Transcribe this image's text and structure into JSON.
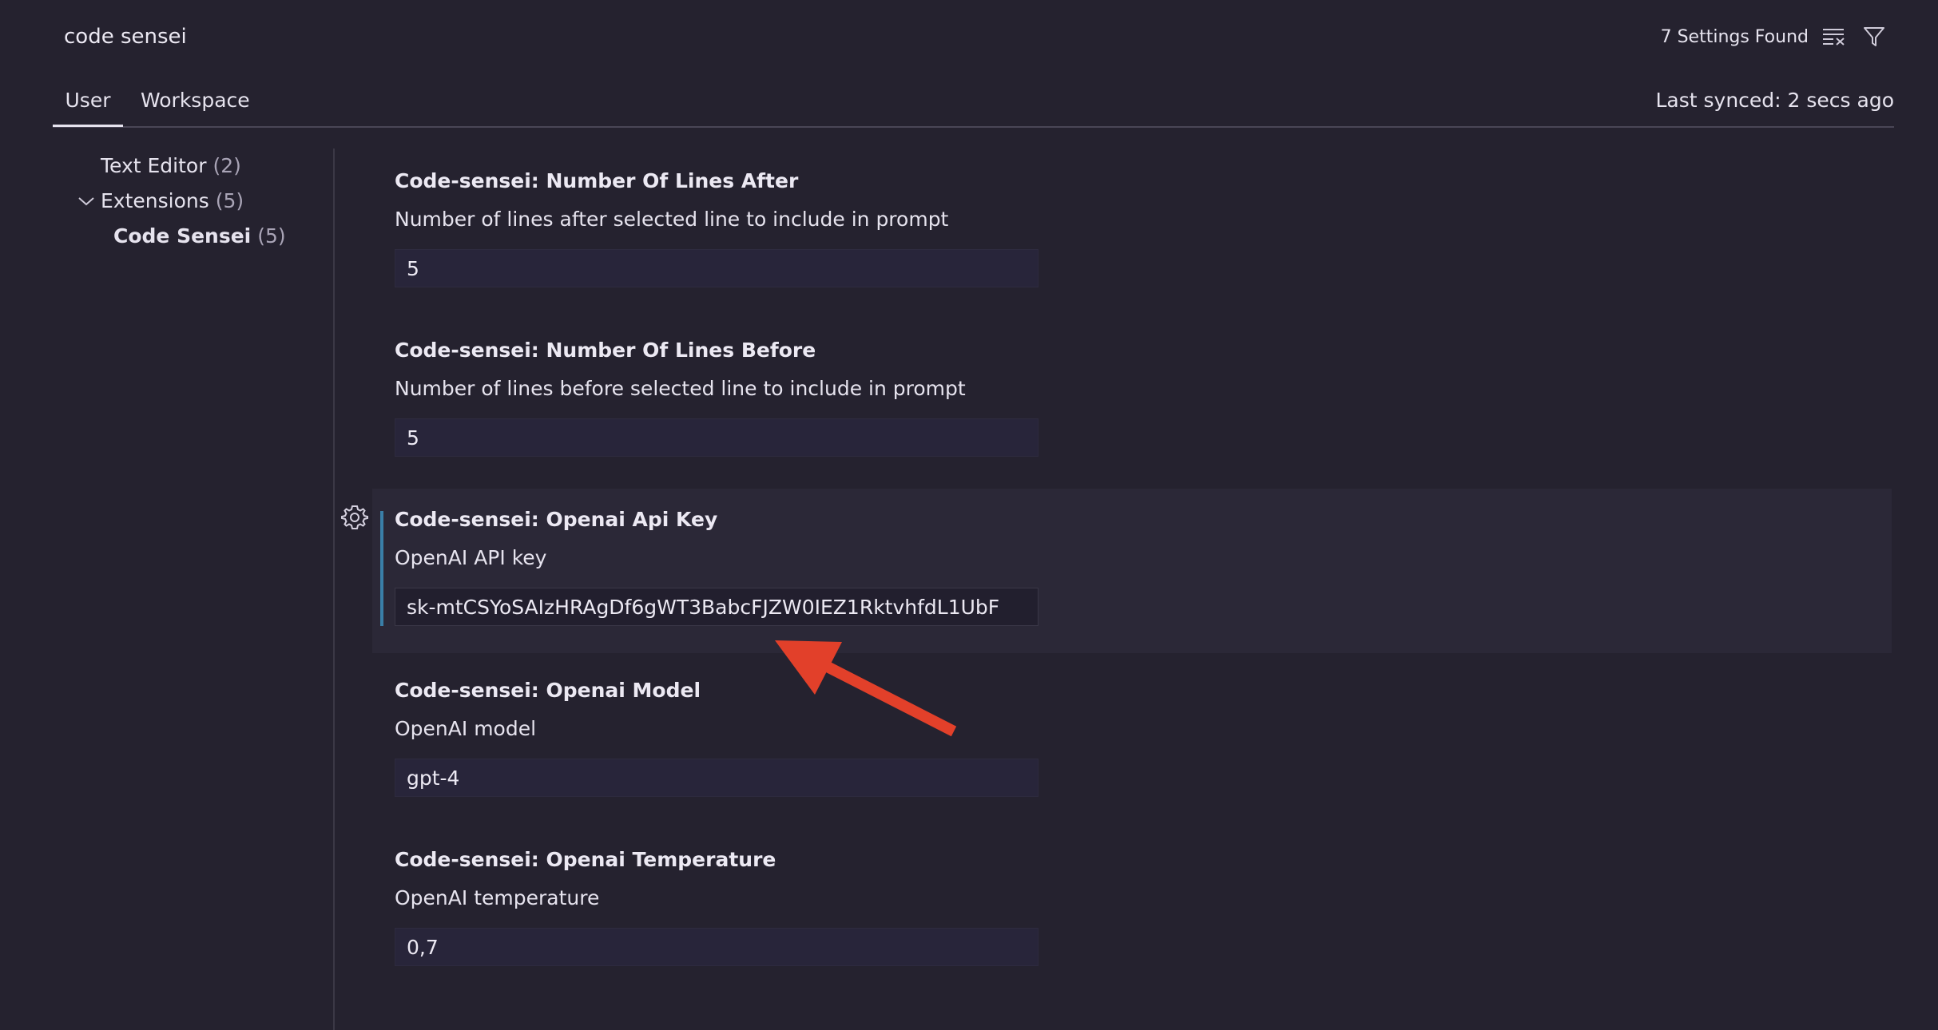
{
  "search": {
    "value": "code sensei",
    "results_count": "7 Settings Found"
  },
  "icons": {
    "clear": "clear-filter-icon",
    "filter": "filter-icon",
    "gear": "gear-icon",
    "chevron": "chevron-down-icon"
  },
  "tabs": {
    "user": "User",
    "workspace": "Workspace",
    "last_synced": "Last synced: 2 secs ago"
  },
  "tree": {
    "text_editor": {
      "label": "Text Editor",
      "count": "(2)"
    },
    "extensions": {
      "label": "Extensions",
      "count": "(5)"
    },
    "code_sensei": {
      "label": "Code Sensei",
      "count": "(5)"
    }
  },
  "settings": [
    {
      "title": "Code-sensei: Number Of Lines After",
      "description": "Number of lines after selected line to include in prompt",
      "value": "5"
    },
    {
      "title": "Code-sensei: Number Of Lines Before",
      "description": "Number of lines before selected line to include in prompt",
      "value": "5"
    },
    {
      "title": "Code-sensei: Openai Api Key",
      "description": "OpenAI API key",
      "value": "sk-mtCSYoSAIzHRAgDf6gWT3BabcFJZW0IEZ1RktvhfdL1UbF"
    },
    {
      "title": "Code-sensei: Openai Model",
      "description": "OpenAI model",
      "value": "gpt-4"
    },
    {
      "title": "Code-sensei: Openai Temperature",
      "description": "OpenAI temperature",
      "value": "0,7"
    }
  ],
  "colors": {
    "background": "#25222f",
    "focus_accent": "#3a7fa8",
    "annotation_arrow": "#e2402a"
  }
}
